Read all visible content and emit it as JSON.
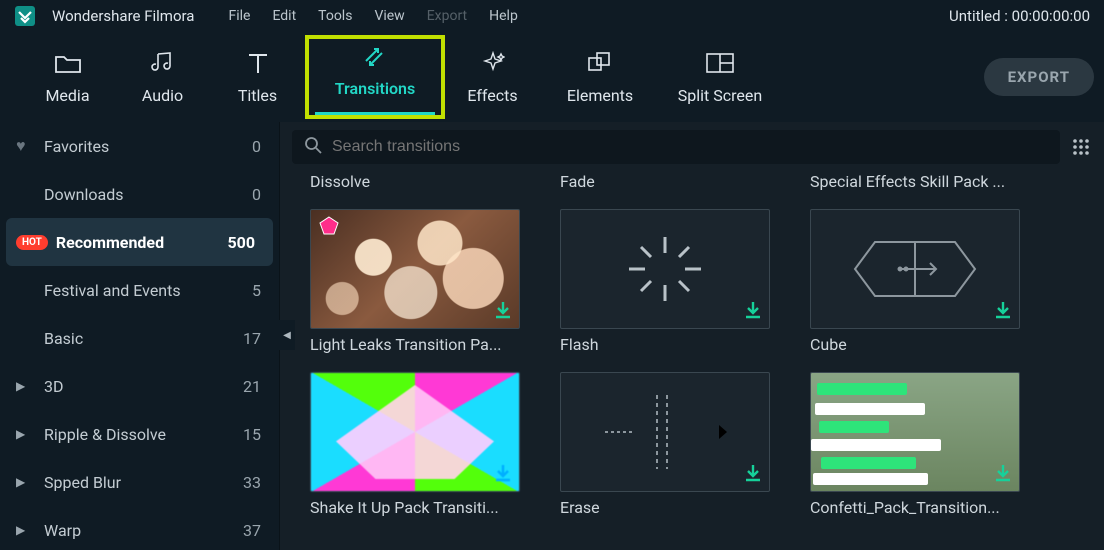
{
  "app": {
    "name": "Wondershare Filmora"
  },
  "titlebar": {
    "menu": [
      "File",
      "Edit",
      "Tools",
      "View",
      "Export",
      "Help"
    ],
    "menu_disabled_index": 4,
    "project_title": "Untitled : 00:00:00:00"
  },
  "toolbar": {
    "items": [
      {
        "key": "media",
        "label": "Media",
        "icon": "folder-icon"
      },
      {
        "key": "audio",
        "label": "Audio",
        "icon": "music-icon"
      },
      {
        "key": "titles",
        "label": "Titles",
        "icon": "text-icon"
      },
      {
        "key": "transitions",
        "label": "Transitions",
        "icon": "transition-icon",
        "active": true,
        "highlight": true
      },
      {
        "key": "effects",
        "label": "Effects",
        "icon": "sparkle-icon"
      },
      {
        "key": "elements",
        "label": "Elements",
        "icon": "shapes-icon"
      },
      {
        "key": "splitscreen",
        "label": "Split Screen",
        "icon": "splitscreen-icon"
      }
    ],
    "export_label": "EXPORT"
  },
  "sidebar": {
    "items": [
      {
        "label": "Favorites",
        "count": 0,
        "icon": "heart"
      },
      {
        "label": "Downloads",
        "count": 0
      },
      {
        "label": "Recommended",
        "count": 500,
        "badge": "HOT",
        "selected": true
      },
      {
        "label": "Festival and Events",
        "count": 5
      },
      {
        "label": "Basic",
        "count": 17
      },
      {
        "label": "3D",
        "count": 21,
        "expandable": true
      },
      {
        "label": "Ripple & Dissolve",
        "count": 15,
        "expandable": true
      },
      {
        "label": "Spped Blur",
        "count": 33,
        "expandable": true
      },
      {
        "label": "Warp",
        "count": 37,
        "expandable": true
      }
    ]
  },
  "search": {
    "placeholder": "Search transitions"
  },
  "grid": {
    "row0": [
      {
        "label": "Dissolve"
      },
      {
        "label": "Fade"
      },
      {
        "label": "Special Effects Skill Pack ..."
      }
    ],
    "row1": [
      {
        "label": "Light Leaks Transition Pa...",
        "type": "bokeh",
        "premium": true,
        "dl": "green"
      },
      {
        "label": "Flash",
        "type": "flash",
        "dl": "green"
      },
      {
        "label": "Cube",
        "type": "cube",
        "dl": "green"
      }
    ],
    "row2": [
      {
        "label": "Shake It Up Pack Transiti...",
        "type": "shake",
        "dl": "blue"
      },
      {
        "label": "Erase",
        "type": "erase",
        "dl": "green"
      },
      {
        "label": "Confetti_Pack_Transition...",
        "type": "confetti",
        "dl": "green"
      }
    ]
  }
}
